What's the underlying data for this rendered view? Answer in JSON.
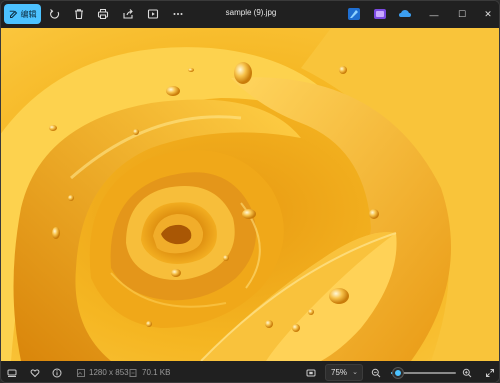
{
  "toolbar": {
    "edit_label": "编辑",
    "icons": [
      "edit-icon",
      "rotate-icon",
      "delete-icon",
      "print-icon",
      "share-icon",
      "slideshow-icon",
      "more-icon"
    ]
  },
  "title": {
    "file_name": "sample (9).jpg"
  },
  "window_controls": {
    "minimize": "—",
    "maximize": "☐",
    "close": "✕"
  },
  "image": {
    "subject": "yellow-rose",
    "colors": {
      "base": "#f4b525",
      "light": "#ffd35a",
      "shadow": "#d88a0c",
      "deep": "#b86a05"
    }
  },
  "status": {
    "dimensions": "1280 x 853",
    "file_size": "70.1 KB",
    "zoom": "75%",
    "zoom_level": 0.1
  },
  "colors": {
    "accent": "#4cc2ff",
    "background": "#202020"
  }
}
